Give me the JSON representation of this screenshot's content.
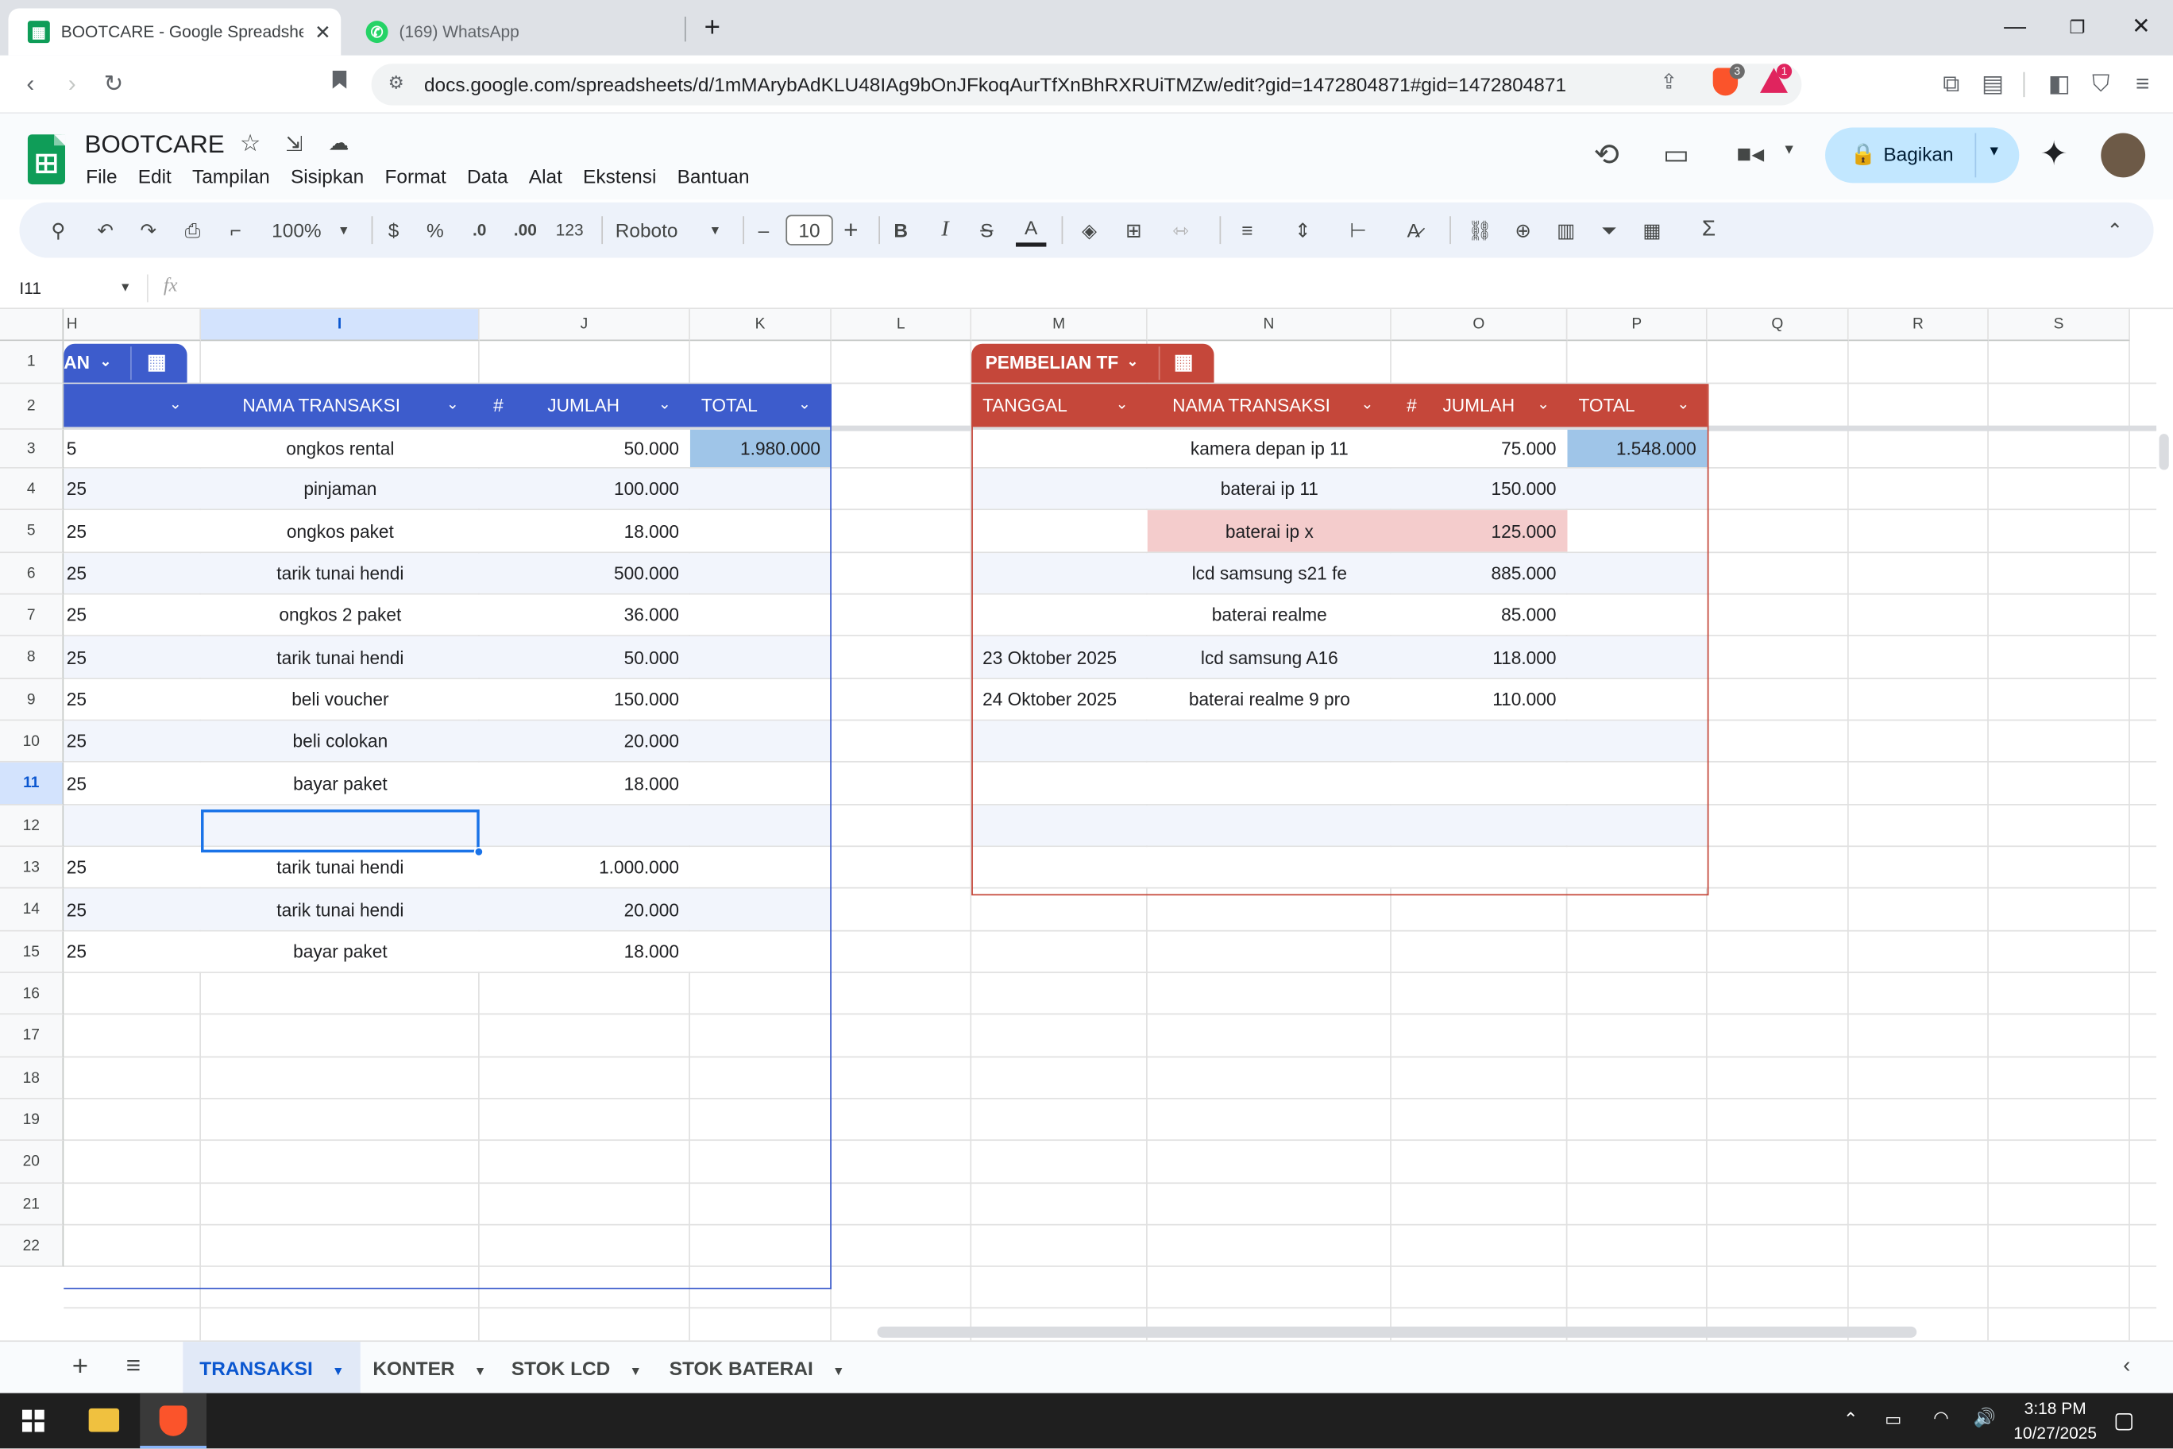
{
  "browser": {
    "tabs": [
      {
        "title": "BOOTCARE - Google Spreadshee",
        "active": true
      },
      {
        "title": "(169) WhatsApp",
        "active": false
      }
    ],
    "url": "docs.google.com/spreadsheets/d/1mMArybAdKLU48IAg9bOnJFkoqAurTfXnBhRXRUiTMZw/edit?gid=1472804871#gid=1472804871",
    "brave_badge": "3",
    "alert_badge": "1"
  },
  "doc": {
    "title": "BOOTCARE",
    "menus": [
      "File",
      "Edit",
      "Tampilan",
      "Sisipkan",
      "Format",
      "Data",
      "Alat",
      "Ekstensi",
      "Bantuan"
    ],
    "share_label": "Bagikan"
  },
  "toolbar": {
    "zoom": "100%",
    "currency": "$",
    "percent": "%",
    "dec_decrease": ".0",
    "dec_increase": ".00",
    "number_format": "123",
    "font": "Roboto",
    "font_size": "10",
    "minus": "–",
    "plus": "+",
    "bold": "B",
    "italic": "I",
    "strike": "S",
    "text_color": "A"
  },
  "formula_bar": {
    "cell_ref": "I11",
    "fx": "fx",
    "value": ""
  },
  "grid": {
    "columns": [
      "H",
      "I",
      "J",
      "K",
      "L",
      "M",
      "N",
      "O",
      "P",
      "Q",
      "R",
      "S"
    ],
    "rows": [
      "1",
      "2",
      "3",
      "4",
      "5",
      "6",
      "7",
      "8",
      "9",
      "10",
      "11",
      "12",
      "13",
      "14",
      "15",
      "16",
      "17",
      "18",
      "19",
      "20",
      "21",
      "22"
    ],
    "selected_row": "11",
    "selected_column": "I"
  },
  "table_left": {
    "chip_label": "AN",
    "accent": "#3d5ccc",
    "headers": [
      "NAMA TRANSAKSI",
      "#",
      "JUMLAH",
      "TOTAL"
    ],
    "first_col_partial": [
      "5",
      "25",
      "25",
      "25",
      "25",
      "25",
      "25",
      "25",
      "25",
      "",
      "25",
      "25",
      "25"
    ],
    "rows": [
      {
        "nama": "ongkos rental",
        "jumlah": "50.000",
        "total": "1.980.000"
      },
      {
        "nama": "pinjaman",
        "jumlah": "100.000",
        "total": ""
      },
      {
        "nama": "ongkos paket",
        "jumlah": "18.000",
        "total": ""
      },
      {
        "nama": "tarik tunai hendi",
        "jumlah": "500.000",
        "total": ""
      },
      {
        "nama": "ongkos 2 paket",
        "jumlah": "36.000",
        "total": ""
      },
      {
        "nama": "tarik tunai hendi",
        "jumlah": "50.000",
        "total": ""
      },
      {
        "nama": "beli voucher",
        "jumlah": "150.000",
        "total": ""
      },
      {
        "nama": "beli colokan",
        "jumlah": "20.000",
        "total": ""
      },
      {
        "nama": "bayar paket",
        "jumlah": "18.000",
        "total": ""
      },
      {
        "nama": "",
        "jumlah": "",
        "total": ""
      },
      {
        "nama": "tarik tunai hendi",
        "jumlah": "1.000.000",
        "total": ""
      },
      {
        "nama": "tarik tunai hendi",
        "jumlah": "20.000",
        "total": ""
      },
      {
        "nama": "bayar paket",
        "jumlah": "18.000",
        "total": ""
      }
    ]
  },
  "table_right": {
    "chip_label": "PEMBELIAN TF",
    "accent": "#c5473a",
    "headers": [
      "TANGGAL",
      "NAMA TRANSAKSI",
      "#",
      "JUMLAH",
      "TOTAL"
    ],
    "rows": [
      {
        "tanggal": "",
        "nama": "kamera depan ip 11",
        "jumlah": "75.000",
        "total": "1.548.000"
      },
      {
        "tanggal": "",
        "nama": "baterai ip 11",
        "jumlah": "150.000",
        "total": ""
      },
      {
        "tanggal": "",
        "nama": "baterai ip x",
        "jumlah": "125.000",
        "total": ""
      },
      {
        "tanggal": "",
        "nama": "lcd samsung s21 fe",
        "jumlah": "885.000",
        "total": ""
      },
      {
        "tanggal": "",
        "nama": "baterai realme",
        "jumlah": "85.000",
        "total": ""
      },
      {
        "tanggal": "23 Oktober 2025",
        "nama": "lcd samsung A16",
        "jumlah": "118.000",
        "total": ""
      },
      {
        "tanggal": "24 Oktober 2025",
        "nama": "baterai realme 9 pro",
        "jumlah": "110.000",
        "total": ""
      },
      {
        "tanggal": "",
        "nama": "",
        "jumlah": "",
        "total": ""
      },
      {
        "tanggal": "",
        "nama": "",
        "jumlah": "",
        "total": ""
      },
      {
        "tanggal": "",
        "nama": "",
        "jumlah": "",
        "total": ""
      },
      {
        "tanggal": "",
        "nama": "",
        "jumlah": "",
        "total": ""
      }
    ]
  },
  "colors": {
    "total_highlight": "#9fc5e8",
    "pink_highlight": "#f4cccc",
    "selection": "#1a73e8"
  },
  "sheet_tabs": [
    {
      "label": "TRANSAKSI",
      "active": true
    },
    {
      "label": "KONTER",
      "active": false
    },
    {
      "label": "STOK LCD",
      "active": false
    },
    {
      "label": "STOK BATERAI",
      "active": false
    }
  ],
  "taskbar": {
    "time": "3:18 PM",
    "date": "10/27/2025"
  }
}
